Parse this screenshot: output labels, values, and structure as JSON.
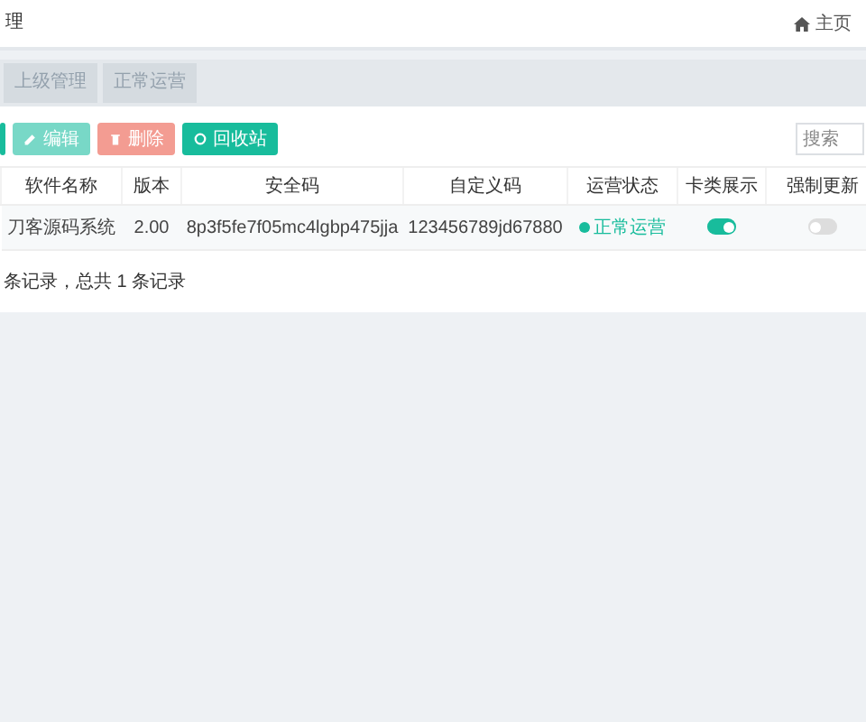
{
  "top_bar": {
    "tab": "理",
    "home": "主页"
  },
  "sub_tabs": [
    {
      "label": "上级管理",
      "selected": false
    },
    {
      "label": "正常运营",
      "selected": false
    }
  ],
  "toolbar": {
    "buttons": [
      {
        "kind": "add"
      },
      {
        "kind": "edit",
        "label": "编辑"
      },
      {
        "kind": "delete",
        "label": "删除"
      },
      {
        "kind": "recycle",
        "label": "回收站"
      }
    ],
    "search": {
      "placeholder": "搜索"
    }
  },
  "table": {
    "columns": [
      "软件名称",
      "版本",
      "安全码",
      "自定义码",
      "运营状态",
      "卡类展示",
      "强制更新"
    ],
    "rows": [
      {
        "name": "刀客源码系统",
        "version": "2.00",
        "security_code": "8p3f5fe7f05mc4lgbp475jja",
        "custom_code": "123456789jd67880",
        "status": "正常运营",
        "color": "#18bc9c",
        "card_display": true,
        "force_update": false
      }
    ]
  },
  "footer": "条记录，总共 1 条记录"
}
